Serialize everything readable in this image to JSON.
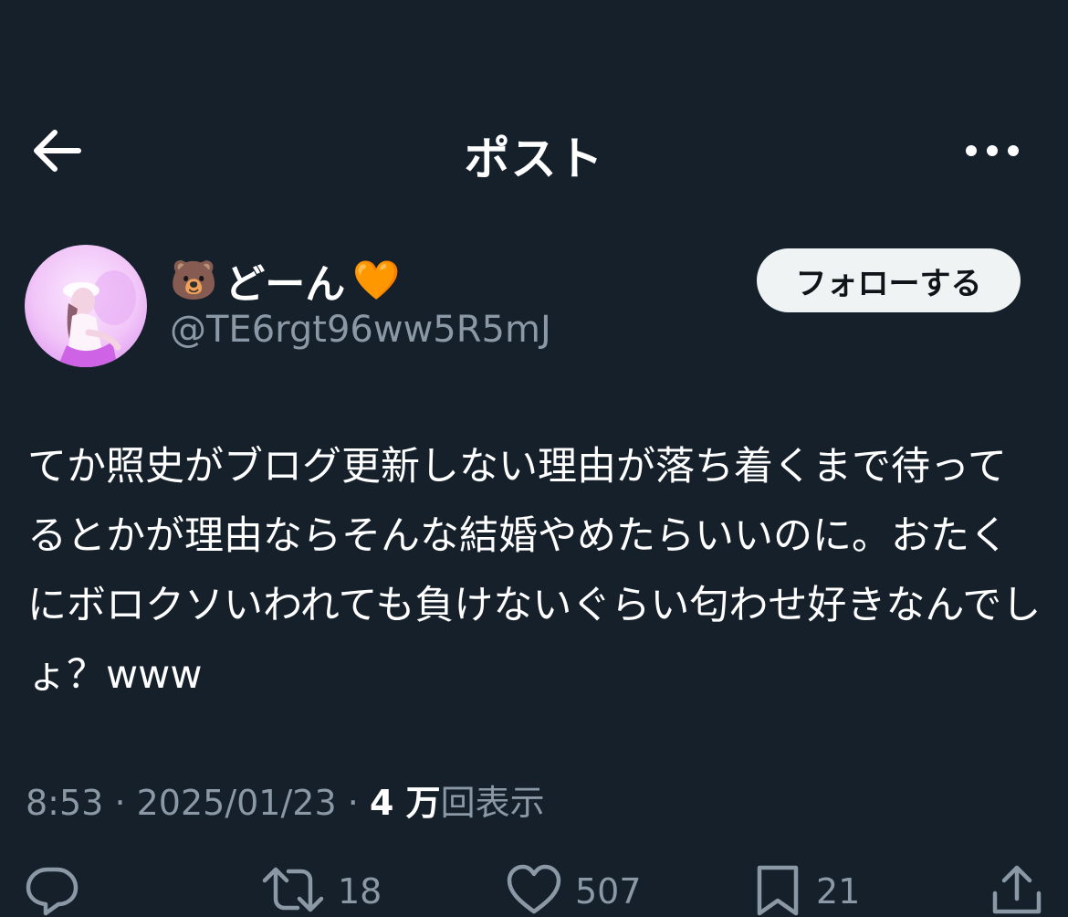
{
  "header": {
    "title": "ポスト",
    "back_icon": "arrow-left-icon",
    "more_icon": "more-horizontal-icon"
  },
  "author": {
    "name_prefix_emoji": "🐻",
    "name": "どーん",
    "name_suffix_emoji": "🧡",
    "handle": "@TE6rgt96ww5R5mJ",
    "follow_label": "フォローする"
  },
  "post": {
    "text": "てか照史がブログ更新しない理由が落ち着くまで待ってるとかが理由ならそんな結婚やめたらいいのに。おたくにボロクソいわれても負けないぐらい匂わせ好きなんでしょ？www",
    "time": "8:53",
    "separator": "·",
    "date": "2025/01/23",
    "views_count": "4 万",
    "views_label": "回表示"
  },
  "actions": {
    "reply": {
      "icon": "reply-icon"
    },
    "repost": {
      "icon": "repost-icon",
      "count": "18"
    },
    "like": {
      "icon": "heart-icon",
      "count": "507"
    },
    "bookmark": {
      "icon": "bookmark-icon",
      "count": "21"
    },
    "share": {
      "icon": "share-icon"
    }
  },
  "colors": {
    "background": "#15202b",
    "text_primary": "#ffffff",
    "text_secondary": "#8b98a5",
    "follow_button_bg": "#eff3f4",
    "follow_button_text": "#0f1419"
  }
}
